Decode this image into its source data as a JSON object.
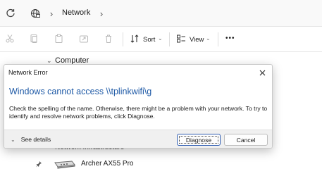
{
  "address_bar": {
    "location": "Network",
    "icons": [
      "refresh-icon",
      "network-globe-icon",
      "chevron-right-icon"
    ]
  },
  "toolbar": {
    "icons": [
      "cut-icon",
      "copy-icon",
      "paste-icon",
      "share-icon",
      "delete-icon"
    ],
    "sort_label": "Sort",
    "view_label": "View",
    "more_label": "•••"
  },
  "content": {
    "section_computer": "Computer",
    "section_infrastructure": "Network Infrastructure",
    "device_name": "Archer AX55 Pro"
  },
  "dialog": {
    "title": "Network Error",
    "heading": "Windows cannot access \\\\tplinkwifi\\g",
    "message": "Check the spelling of the name. Otherwise, there might be a problem with your network. To try to identify and resolve network problems, click Diagnose.",
    "details_label": "See details",
    "diagnose_label": "Diagnose",
    "cancel_label": "Cancel"
  },
  "colors": {
    "heading": "#1f5aa6",
    "default_button_border": "#2f5db2"
  }
}
